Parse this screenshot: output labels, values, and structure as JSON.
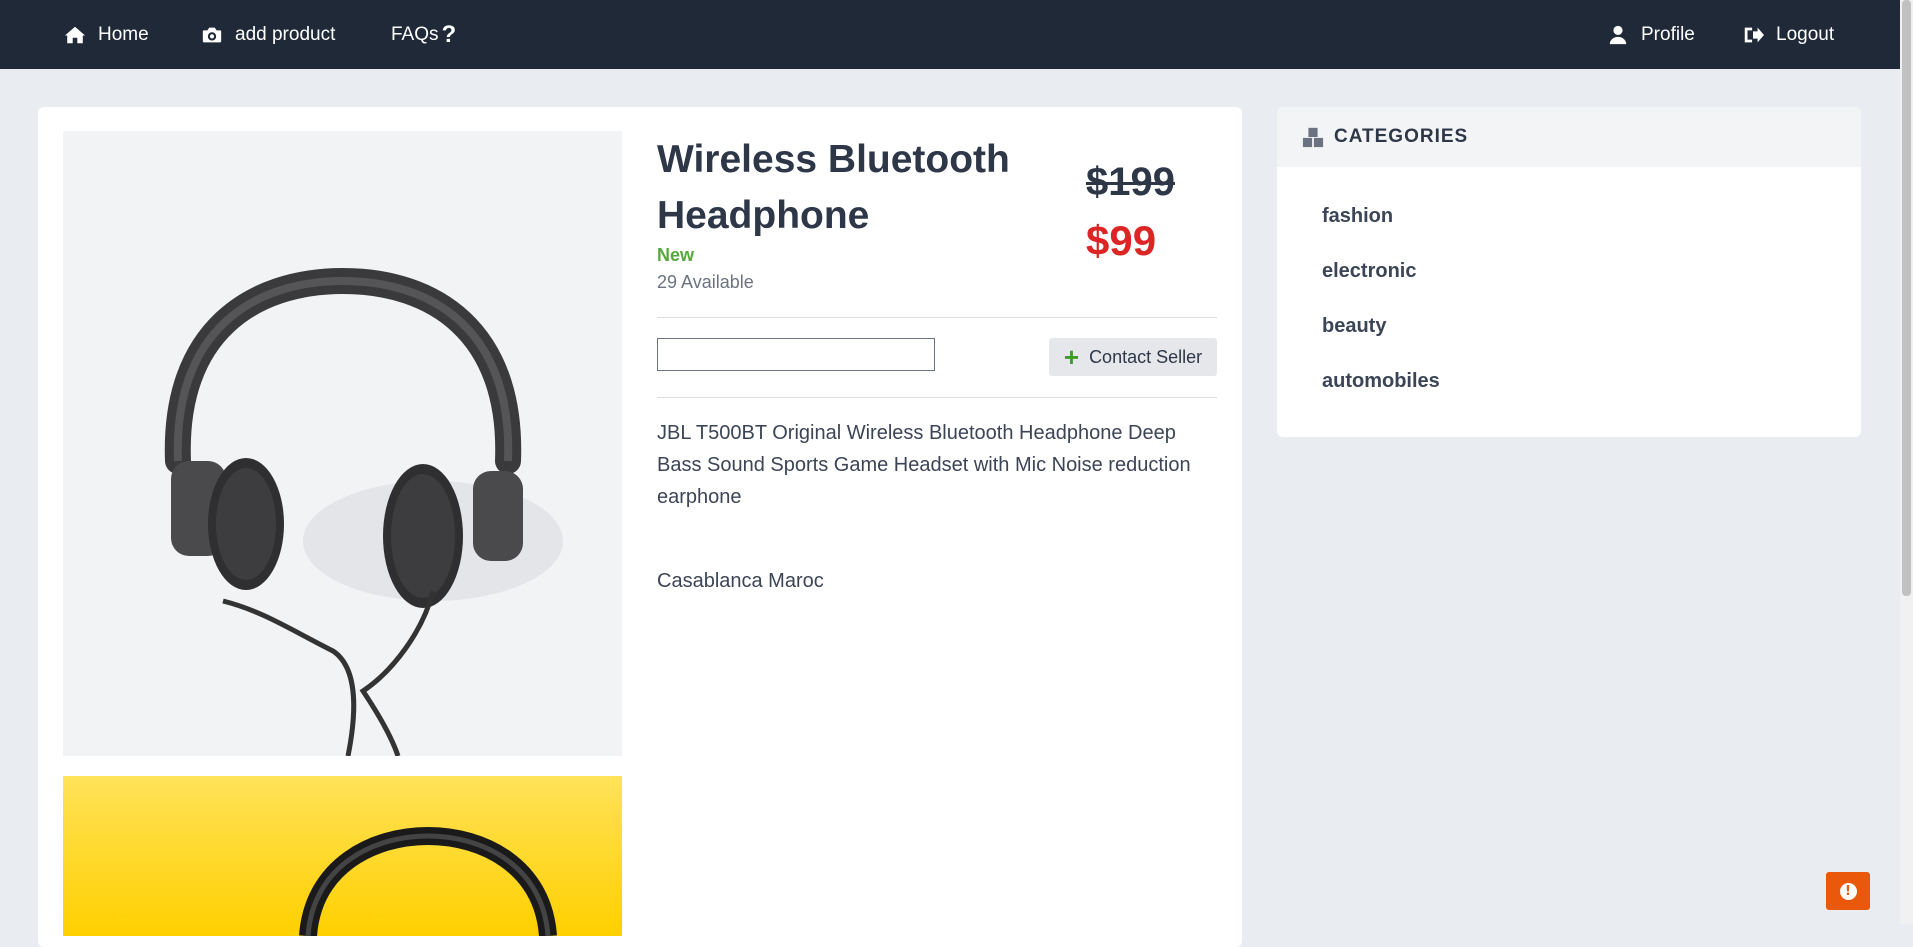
{
  "nav": {
    "home": "Home",
    "add_product": "add product",
    "faqs": "FAQs",
    "profile": "Profile",
    "logout": "Logout"
  },
  "product": {
    "title": "Wireless Bluetooth Headphone",
    "condition": "New",
    "available": "29 Available",
    "old_price": "$199",
    "new_price": "$99",
    "quantity_value": "",
    "contact_label": "Contact Seller",
    "description": "JBL T500BT Original Wireless Bluetooth Headphone Deep Bass Sound Sports Game Headset with Mic Noise reduction earphone",
    "location": "Casablanca Maroc"
  },
  "categories": {
    "header": "CATEGORIES",
    "items": [
      "fashion",
      "electronic",
      "beauty",
      "automobiles"
    ]
  },
  "icons": {
    "home": "home-icon",
    "add_product": "camera-icon",
    "faqs": "question-icon",
    "profile": "user-icon",
    "logout": "logout-icon",
    "categories": "boxes-icon",
    "contact": "plus-icon",
    "alert": "exclamation-icon"
  },
  "colors": {
    "navbar": "#1f2937",
    "new_price": "#dc2626",
    "condition": "#56a83a",
    "alert": "#ea580c"
  }
}
